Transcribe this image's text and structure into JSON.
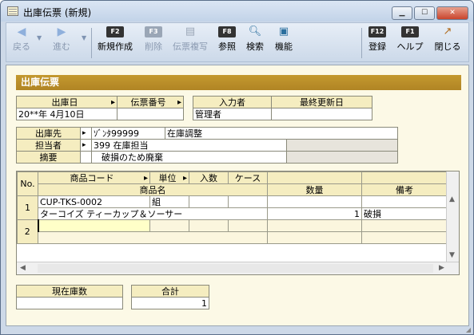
{
  "window": {
    "title": "出庫伝票 (新規)",
    "min_label": "▁",
    "max_label": "☐",
    "close_label": "✕"
  },
  "toolbar": {
    "back": "戻る",
    "forward": "進む",
    "new_key": "F2",
    "new": "新規作成",
    "delete_key": "F3",
    "delete": "削除",
    "copy": "伝票複写",
    "ref_key": "F8",
    "ref": "参照",
    "search": "検索",
    "functions": "機能",
    "register_key": "F12",
    "register": "登録",
    "help_key": "F1",
    "help": "ヘルプ",
    "close": "閉じる"
  },
  "form": {
    "header": "出庫伝票",
    "labels": {
      "ship_date": "出庫日",
      "slip_no": "伝票番号",
      "entered_by": "入力者",
      "last_updated": "最終更新日",
      "destination": "出庫先",
      "person": "担当者",
      "summary": "摘要"
    },
    "values": {
      "ship_date": "20**年 4月10日",
      "slip_no": "",
      "entered_by": "管理者",
      "last_updated": "",
      "dest_code": "ｿﾞﾝﾀ99999",
      "dest_name": "在庫調整",
      "person_code": "399",
      "person_name": "在庫担当",
      "summary": "破損のため廃棄"
    }
  },
  "grid": {
    "headers": {
      "no": "No.",
      "product_code": "商品コード",
      "unit": "単位",
      "qty_per": "入数",
      "case": "ケース",
      "product_name": "商品名",
      "quantity": "数量",
      "note": "備考"
    },
    "rows": [
      {
        "no": "1",
        "code": "CUP-TKS-0002",
        "unit": "組",
        "name": "ターコイズ ティーカップ＆ソーサー",
        "qty": "1",
        "note": "破損"
      },
      {
        "no": "2",
        "code": "",
        "unit": "",
        "name": "",
        "qty": "",
        "note": ""
      }
    ]
  },
  "footer": {
    "stock_label": "現在庫数",
    "stock_value": "",
    "total_label": "合計",
    "total_value": "1"
  }
}
